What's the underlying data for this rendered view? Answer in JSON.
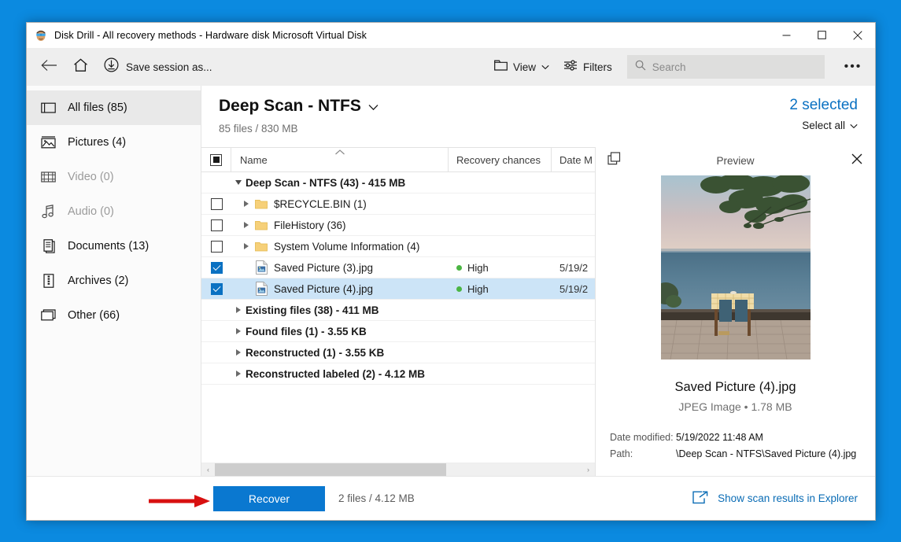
{
  "window": {
    "title": "Disk Drill - All recovery methods - Hardware disk Microsoft Virtual Disk",
    "app_icon": "disk-drill-icon",
    "controls": {
      "minimize": "—",
      "maximize": "☐",
      "close": "✕"
    }
  },
  "toolbar": {
    "back_icon": "back-arrow-icon",
    "home_icon": "home-icon",
    "save_session_icon": "download-icon",
    "save_session_label": "Save session as...",
    "view_icon": "folder-icon",
    "view_label": "View",
    "filters_icon": "filters-icon",
    "filters_label": "Filters",
    "search_icon": "search-icon",
    "search_placeholder": "Search",
    "search_value": "",
    "more_label": "•••"
  },
  "sidebar": {
    "items": [
      {
        "icon": "all-files-icon",
        "label": "All files (85)",
        "active": true,
        "disabled": false
      },
      {
        "icon": "pictures-icon",
        "label": "Pictures (4)",
        "active": false,
        "disabled": false
      },
      {
        "icon": "video-icon",
        "label": "Video (0)",
        "active": false,
        "disabled": true
      },
      {
        "icon": "audio-icon",
        "label": "Audio (0)",
        "active": false,
        "disabled": true
      },
      {
        "icon": "documents-icon",
        "label": "Documents (13)",
        "active": false,
        "disabled": false
      },
      {
        "icon": "archives-icon",
        "label": "Archives (2)",
        "active": false,
        "disabled": false
      },
      {
        "icon": "other-icon",
        "label": "Other (66)",
        "active": false,
        "disabled": false
      }
    ]
  },
  "main": {
    "scan_title": "Deep Scan - NTFS",
    "scan_subtitle": "85 files / 830 MB",
    "selected_count": "2 selected",
    "select_all": "Select all"
  },
  "table": {
    "columns": {
      "name": "Name",
      "recovery": "Recovery chances",
      "date": "Date M"
    },
    "sort_indicator": "ascending",
    "header_checkbox": "partial",
    "rows": [
      {
        "type": "group",
        "depth": 0,
        "expanded": true,
        "checkbox": "none",
        "label": "Deep Scan - NTFS (43) - 415 MB",
        "icon": "none",
        "recovery": "",
        "date": ""
      },
      {
        "type": "folder",
        "depth": 1,
        "expanded": false,
        "checkbox": "unchecked",
        "label": "$RECYCLE.BIN (1)",
        "icon": "folder",
        "recovery": "",
        "date": ""
      },
      {
        "type": "folder",
        "depth": 1,
        "expanded": false,
        "checkbox": "unchecked",
        "label": "FileHistory (36)",
        "icon": "folder",
        "recovery": "",
        "date": ""
      },
      {
        "type": "folder",
        "depth": 1,
        "expanded": false,
        "checkbox": "unchecked",
        "label": "System Volume Information (4)",
        "icon": "folder",
        "recovery": "",
        "date": ""
      },
      {
        "type": "file",
        "depth": 1,
        "expanded": null,
        "checkbox": "checked",
        "label": "Saved Picture (3).jpg",
        "icon": "image",
        "recovery": "High",
        "date": "5/19/2"
      },
      {
        "type": "file",
        "depth": 1,
        "expanded": null,
        "checkbox": "checked",
        "label": "Saved Picture (4).jpg",
        "icon": "image",
        "recovery": "High",
        "date": "5/19/2",
        "selected": true
      },
      {
        "type": "group",
        "depth": 0,
        "expanded": false,
        "checkbox": "none",
        "label": "Existing files (38) - 411 MB",
        "icon": "none",
        "recovery": "",
        "date": ""
      },
      {
        "type": "group",
        "depth": 0,
        "expanded": false,
        "checkbox": "none",
        "label": "Found files (1) - 3.55 KB",
        "icon": "none",
        "recovery": "",
        "date": ""
      },
      {
        "type": "group",
        "depth": 0,
        "expanded": false,
        "checkbox": "none",
        "label": "Reconstructed (1) - 3.55 KB",
        "icon": "none",
        "recovery": "",
        "date": ""
      },
      {
        "type": "group",
        "depth": 0,
        "expanded": false,
        "checkbox": "none",
        "label": "Reconstructed labeled (2) - 4.12 MB",
        "icon": "none",
        "recovery": "",
        "date": ""
      }
    ],
    "scroll_left_arrow": "‹",
    "scroll_right_arrow": "›"
  },
  "preview": {
    "popout_icon": "popout-icon",
    "title": "Preview",
    "close_icon": "close-icon",
    "image_alt": "seaside-table-photo",
    "file_name": "Saved Picture (4).jpg",
    "file_meta": "JPEG Image • 1.78 MB",
    "details": [
      {
        "key": "Date modified:",
        "value": "5/19/2022 11:48 AM"
      },
      {
        "key": "Path:",
        "value": "\\Deep Scan - NTFS\\Saved Picture (4).jpg"
      }
    ]
  },
  "footer": {
    "recover_label": "Recover",
    "status": "2 files / 4.12 MB",
    "explorer_icon": "open-external-icon",
    "explorer_label": "Show scan results in Explorer"
  },
  "annotation": {
    "arrow": "red-arrow-pointing-to-recover"
  },
  "colors": {
    "accent": "#0a78d0",
    "link": "#0a6cb5",
    "selection": "#cce4f7",
    "desktop": "#0b8ae0",
    "high_chance": "#4bb543",
    "annotation_red": "#d81010"
  }
}
